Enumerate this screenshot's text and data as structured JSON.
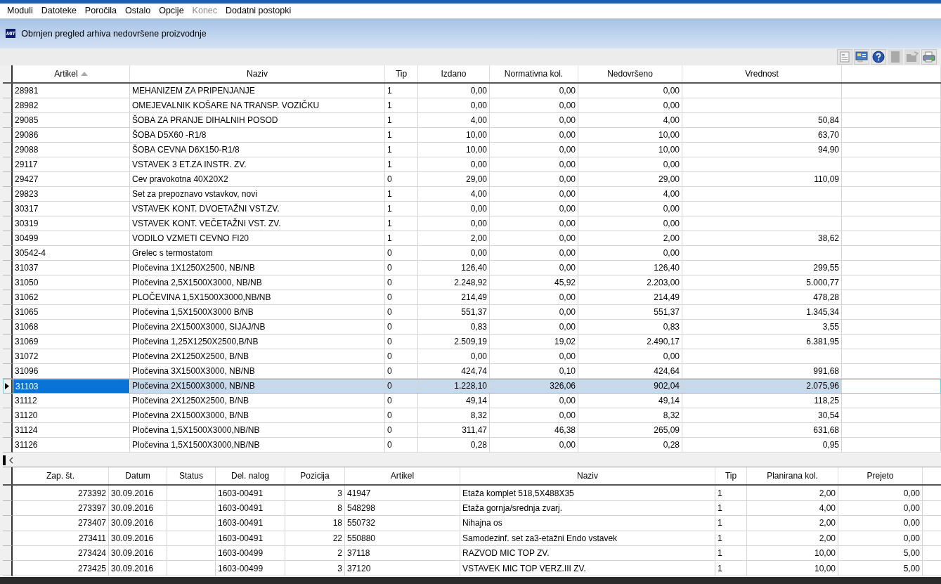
{
  "menu": [
    {
      "label": "Moduli",
      "disabled": false
    },
    {
      "label": "Datoteke",
      "disabled": false
    },
    {
      "label": "Poročila",
      "disabled": false
    },
    {
      "label": "Ostalo",
      "disabled": false
    },
    {
      "label": "Opcije",
      "disabled": false
    },
    {
      "label": "Konec",
      "disabled": true
    },
    {
      "label": "Dodatni postopki",
      "disabled": false
    }
  ],
  "window": {
    "logo": "MIT",
    "title": "Obrnjen pregled arhiva nedovršene proizvodnje"
  },
  "toolbar": [
    {
      "kind": "document",
      "disabled": false
    },
    {
      "kind": "screen",
      "disabled": false
    },
    {
      "kind": "help",
      "disabled": false
    },
    {
      "kind": "page",
      "disabled": true
    },
    {
      "kind": "folder",
      "disabled": true
    },
    {
      "kind": "printer",
      "disabled": false
    }
  ],
  "top_table": {
    "columns": [
      {
        "label": "Artikel",
        "sorted": true
      },
      {
        "label": "Naziv",
        "sorted": false
      },
      {
        "label": "Tip",
        "sorted": false
      },
      {
        "label": "Izdano",
        "sorted": false
      },
      {
        "label": "Normativna kol.",
        "sorted": false
      },
      {
        "label": "Nedovršeno",
        "sorted": false
      },
      {
        "label": "Vrednost",
        "sorted": false
      }
    ],
    "rows": [
      {
        "selected": false,
        "cells": [
          "28981",
          "MEHANIZEM ZA PRIPENJANJE",
          "1",
          "0,00",
          "0,00",
          "0,00",
          ""
        ]
      },
      {
        "selected": false,
        "cells": [
          "28982",
          "OMEJEVALNIK KOŠARE NA TRANSP. VOZIČKU",
          "1",
          "0,00",
          "0,00",
          "0,00",
          ""
        ]
      },
      {
        "selected": false,
        "cells": [
          "29085",
          "ŠOBA ZA PRANJE DIHALNIH POSOD",
          "1",
          "4,00",
          "0,00",
          "4,00",
          "50,84"
        ]
      },
      {
        "selected": false,
        "cells": [
          "29086",
          "ŠOBA D5X60 -R1/8",
          "1",
          "10,00",
          "0,00",
          "10,00",
          "63,70"
        ]
      },
      {
        "selected": false,
        "cells": [
          "29088",
          "ŠOBA CEVNA D6X150-R1/8",
          "1",
          "10,00",
          "0,00",
          "10,00",
          "94,90"
        ]
      },
      {
        "selected": false,
        "cells": [
          "29117",
          "VSTAVEK 3 ET.ZA INSTR. ZV.",
          "1",
          "0,00",
          "0,00",
          "0,00",
          ""
        ]
      },
      {
        "selected": false,
        "cells": [
          "29427",
          "Cev pravokotna 40X20X2",
          "0",
          "29,00",
          "0,00",
          "29,00",
          "110,09"
        ]
      },
      {
        "selected": false,
        "cells": [
          "29823",
          "Set za prepoznavo vstavkov, novi",
          "1",
          "4,00",
          "0,00",
          "4,00",
          ""
        ]
      },
      {
        "selected": false,
        "cells": [
          "30317",
          "VSTAVEK KONT. DVOETAŽNI VST.ZV.",
          "1",
          "0,00",
          "0,00",
          "0,00",
          ""
        ]
      },
      {
        "selected": false,
        "cells": [
          "30319",
          "VSTAVEK KONT. VEČETAŽNI VST. ZV.",
          "1",
          "0,00",
          "0,00",
          "0,00",
          ""
        ]
      },
      {
        "selected": false,
        "cells": [
          "30499",
          "VODILO VZMETI CEVNO FI20",
          "1",
          "2,00",
          "0,00",
          "2,00",
          "38,62"
        ]
      },
      {
        "selected": false,
        "cells": [
          "30542-4",
          "Grelec s termostatom",
          "0",
          "0,00",
          "0,00",
          "0,00",
          ""
        ]
      },
      {
        "selected": false,
        "cells": [
          "31037",
          "Pločevina 1X1250X2500, NB/NB",
          "0",
          "126,40",
          "0,00",
          "126,40",
          "299,55"
        ]
      },
      {
        "selected": false,
        "cells": [
          "31050",
          "Pločevina 2,5X1500X3000, NB/NB",
          "0",
          "2.248,92",
          "45,92",
          "2.203,00",
          "5.000,77"
        ]
      },
      {
        "selected": false,
        "cells": [
          "31062",
          "PLOČEVINA 1,5X1500X3000,NB/NB",
          "0",
          "214,49",
          "0,00",
          "214,49",
          "478,28"
        ]
      },
      {
        "selected": false,
        "cells": [
          "31065",
          "Pločevina 1,5X1500X3000 B/NB",
          "0",
          "551,37",
          "0,00",
          "551,37",
          "1.345,34"
        ]
      },
      {
        "selected": false,
        "cells": [
          "31068",
          "Pločevina 2X1500X3000, SIJAJ/NB",
          "0",
          "0,83",
          "0,00",
          "0,83",
          "3,55"
        ]
      },
      {
        "selected": false,
        "cells": [
          "31069",
          "Pločevina 1,25X1250X2500,B/NB",
          "0",
          "2.509,19",
          "19,02",
          "2.490,17",
          "6.381,95"
        ]
      },
      {
        "selected": false,
        "cells": [
          "31072",
          "Pločevina 2X1250X2500, B/NB",
          "0",
          "0,00",
          "0,00",
          "0,00",
          ""
        ]
      },
      {
        "selected": false,
        "cells": [
          "31096",
          "Pločevina 3X1500X3000, NB/NB",
          "0",
          "424,74",
          "0,10",
          "424,64",
          "991,68"
        ]
      },
      {
        "selected": true,
        "cells": [
          "31103",
          "Pločevina 2X1500X3000, NB/NB",
          "0",
          "1.228,10",
          "326,06",
          "902,04",
          "2.075,96"
        ]
      },
      {
        "selected": false,
        "cells": [
          "31112",
          "Pločevina 2X1250X2500, B/NB",
          "0",
          "49,14",
          "0,00",
          "49,14",
          "118,25"
        ]
      },
      {
        "selected": false,
        "cells": [
          "31120",
          "Pločevina 2X1500X3000, B/NB",
          "0",
          "8,32",
          "0,00",
          "8,32",
          "30,54"
        ]
      },
      {
        "selected": false,
        "cells": [
          "31124",
          "Pločevina 1,5X1500X3000,NB/NB",
          "0",
          "311,47",
          "46,38",
          "265,09",
          "631,68"
        ]
      },
      {
        "selected": false,
        "cells": [
          "31126",
          "Pločevina 1,5X1500X3000,NB/NB",
          "0",
          "0,28",
          "0,00",
          "0,28",
          "0,95"
        ]
      }
    ]
  },
  "bottom_table": {
    "columns": [
      {
        "label": "Zap. št."
      },
      {
        "label": "Datum"
      },
      {
        "label": "Status"
      },
      {
        "label": "Del. nalog"
      },
      {
        "label": "Pozicija"
      },
      {
        "label": "Artikel"
      },
      {
        "label": "Naziv"
      },
      {
        "label": "Tip"
      },
      {
        "label": "Planirana kol."
      },
      {
        "label": "Prejeto"
      }
    ],
    "rows": [
      {
        "cells": [
          "273392",
          "30.09.2016",
          "",
          "1603-00491",
          "3",
          "41947",
          "Etaža komplet 518,5X488X35",
          "1",
          "2,00",
          "0,00"
        ]
      },
      {
        "cells": [
          "273397",
          "30.09.2016",
          "",
          "1603-00491",
          "8",
          "548298",
          "Etaža gornja/srednja zvarj.",
          "1",
          "4,00",
          "0,00"
        ]
      },
      {
        "cells": [
          "273407",
          "30.09.2016",
          "",
          "1603-00491",
          "18",
          "550732",
          "Nihajna os",
          "1",
          "2,00",
          "0,00"
        ]
      },
      {
        "cells": [
          "273411",
          "30.09.2016",
          "",
          "1603-00491",
          "22",
          "550880",
          "Samodezinf. set za3-etažni Endo vstavek",
          "1",
          "2,00",
          "0,00"
        ]
      },
      {
        "cells": [
          "273424",
          "30.09.2016",
          "",
          "1603-00499",
          "2",
          "37118",
          "RAZVOD MIC TOP ZV.",
          "1",
          "10,00",
          "5,00"
        ]
      },
      {
        "cells": [
          "273425",
          "30.09.2016",
          "",
          "1603-00499",
          "3",
          "37120",
          "VSTAVEK MIC TOP VERZ.III ZV.",
          "1",
          "10,00",
          "5,00"
        ]
      }
    ]
  }
}
